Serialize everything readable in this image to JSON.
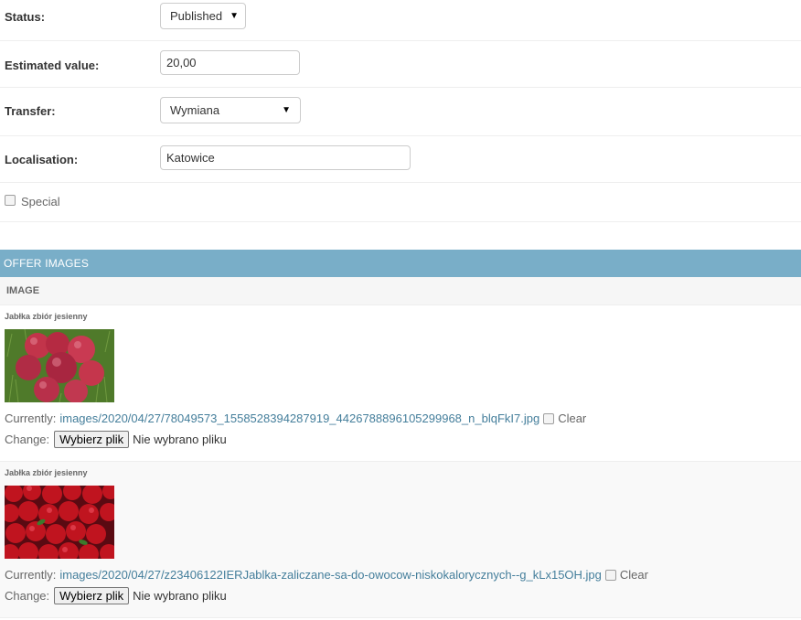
{
  "form": {
    "status": {
      "label": "Status:",
      "value": "Published"
    },
    "estimated_value": {
      "label": "Estimated value:",
      "value": "20,00"
    },
    "transfer": {
      "label": "Transfer:",
      "value": "Wymiana"
    },
    "localisation": {
      "label": "Localisation:",
      "value": "Katowice"
    },
    "special": {
      "label": "Special",
      "checked": false
    }
  },
  "offer_images": {
    "title": "OFFER IMAGES",
    "column_header": "IMAGE",
    "items": [
      {
        "caption": "Jabłka zbiór jesienny",
        "currently_label": "Currently:",
        "file": "images/2020/04/27/78049573_1558528394287919_4426788896105299968_n_blqFkI7.jpg",
        "clear_label": "Clear",
        "change_label": "Change:",
        "choose_button": "Wybierz plik",
        "no_file": "Nie wybrano pliku"
      },
      {
        "caption": "Jabłka zbiór jesienny",
        "currently_label": "Currently:",
        "file": "images/2020/04/27/z23406122IERJablka-zaliczane-sa-do-owocow-niskokalorycznych--g_kLx15OH.jpg",
        "clear_label": "Clear",
        "change_label": "Change:",
        "choose_button": "Wybierz plik",
        "no_file": "Nie wybrano pliku"
      }
    ]
  },
  "colors": {
    "module_header": "#79aec8",
    "link": "#447e9b"
  }
}
